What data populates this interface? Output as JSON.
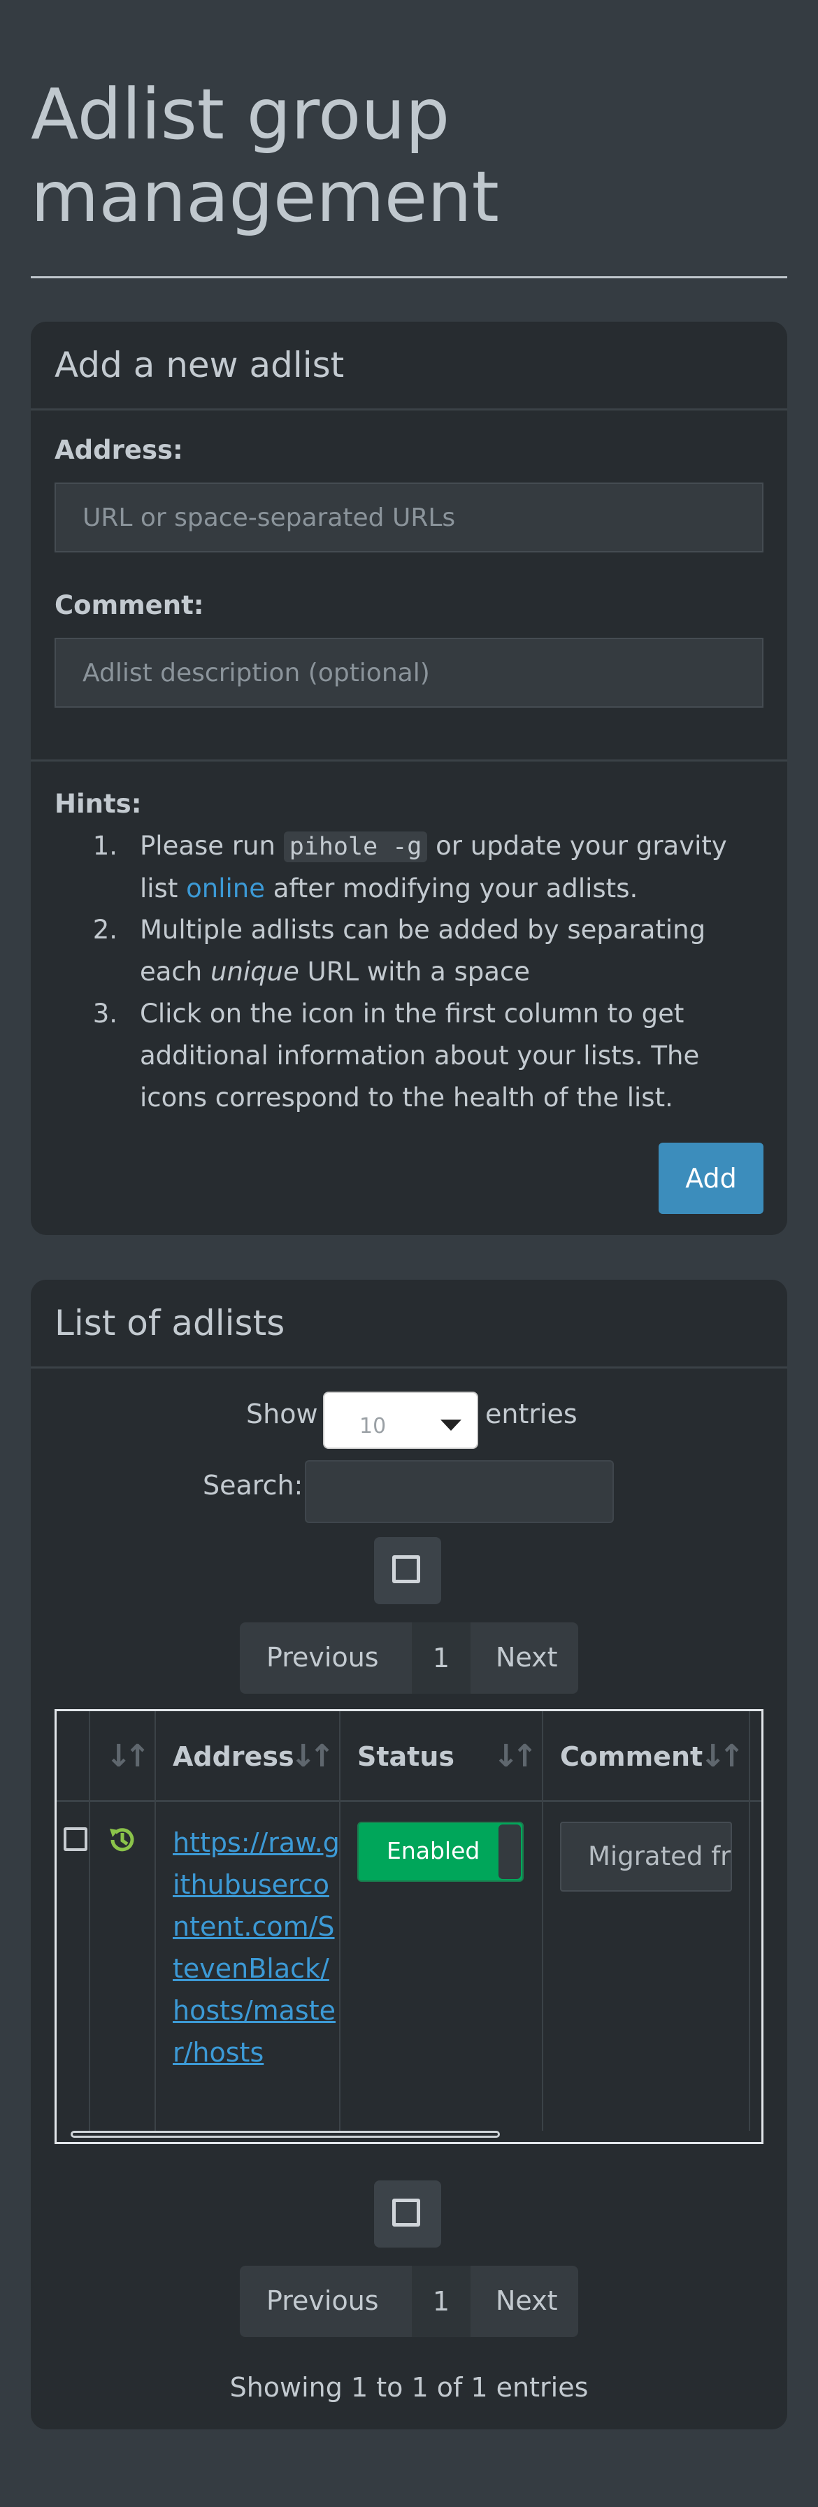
{
  "page": {
    "title": "Adlist group management"
  },
  "add_box": {
    "title": "Add a new adlist",
    "address_label": "Address:",
    "address_placeholder": "URL or space-separated URLs",
    "comment_label": "Comment:",
    "comment_placeholder": "Adlist description (optional)",
    "hints_label": "Hints:",
    "hints": [
      {
        "num": "1.",
        "pre": "Please run ",
        "code": "pihole -g",
        "mid": " or update your gravity list ",
        "link": "online",
        "post": " after modifying your adlists."
      },
      {
        "num": "2.",
        "pre": "Multiple adlists can be added by separating each ",
        "em": "unique",
        "post": " URL with a space"
      },
      {
        "num": "3.",
        "text": "Click on the icon in the first column to get additional information about your lists. The icons correspond to the health of the list."
      }
    ],
    "add_button": "Add"
  },
  "list_box": {
    "title": "List of adlists",
    "show_label": "Show",
    "entries_label": "entries",
    "page_length": "10",
    "search_label": "Search:",
    "pager": {
      "previous": "Previous",
      "page": "1",
      "next": "Next"
    },
    "columns": [
      "",
      "",
      "Address",
      "Status",
      "Comment"
    ],
    "rows": [
      {
        "address": "https://raw.githubusercontent.com/StevenBlack/hosts/master/hosts",
        "status": "Enabled",
        "comment": "Migrated from /etc/pihole/adlists.list"
      }
    ],
    "info": "Showing 1 to 1 of 1 entries"
  },
  "colors": {
    "background": "#353c42",
    "box": "#272c30",
    "primary": "#3c8dbc",
    "link": "#3c9ad6",
    "enabled": "#00a65a",
    "health_ok": "#8bc34a"
  },
  "icons": {
    "sort": "sort-arrows-icon",
    "health": "history-icon",
    "select_all": "checkbox-icon"
  }
}
